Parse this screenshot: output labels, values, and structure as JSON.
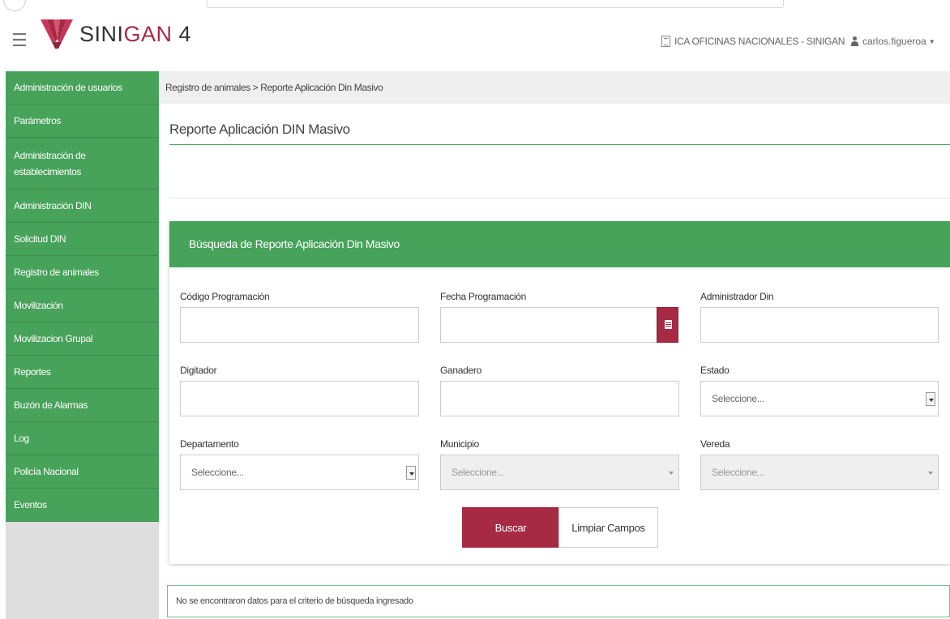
{
  "header": {
    "logo_prefix": "SINI",
    "logo_accent": "GAN",
    "version": "4",
    "office": "ICA OFICINAS NACIONALES - SINIGAN",
    "user": "carlos.figueroa"
  },
  "sidebar": {
    "items": [
      {
        "label": "Administración de usuarios"
      },
      {
        "label": "Parámetros"
      },
      {
        "label": "Administración de establecimientos"
      },
      {
        "label": "Administración DIN"
      },
      {
        "label": "Solicitud DIN"
      },
      {
        "label": "Registro de animales"
      },
      {
        "label": "Movilización"
      },
      {
        "label": "Movilizacion Grupal"
      },
      {
        "label": "Reportes"
      },
      {
        "label": "Buzón de Alarmas"
      },
      {
        "label": "Log"
      },
      {
        "label": "Policía Nacional"
      },
      {
        "label": "Eventos"
      }
    ]
  },
  "breadcrumb": "Registro de animales > Reporte Aplicación Din Masivo",
  "page_title": "Reporte Aplicación DIN Masivo",
  "search_panel": {
    "title": "Búsqueda de Reporte Aplicación Din Masivo",
    "labels": {
      "codigo": "Código Programación",
      "fecha": "Fecha Programación",
      "administrador": "Administrador Din",
      "digitador": "Digitador",
      "ganadero": "Ganadero",
      "estado": "Estado",
      "departamento": "Departamento",
      "municipio": "Municipio",
      "vereda": "Vereda"
    },
    "values": {
      "codigo": "",
      "fecha": "",
      "administrador": "",
      "digitador": "",
      "ganadero": ""
    },
    "selects": {
      "estado": "Seleccione...",
      "departamento": "Seleccione...",
      "municipio": "Seleccione...",
      "vereda": "Seleccione..."
    },
    "buttons": {
      "search": "Buscar",
      "clear": "Limpiar Campos"
    }
  },
  "result_message": "No se encontraron datos para el criterio de búsqueda ingresado",
  "colors": {
    "brand_green": "#47a25a",
    "brand_red": "#a72a45"
  }
}
